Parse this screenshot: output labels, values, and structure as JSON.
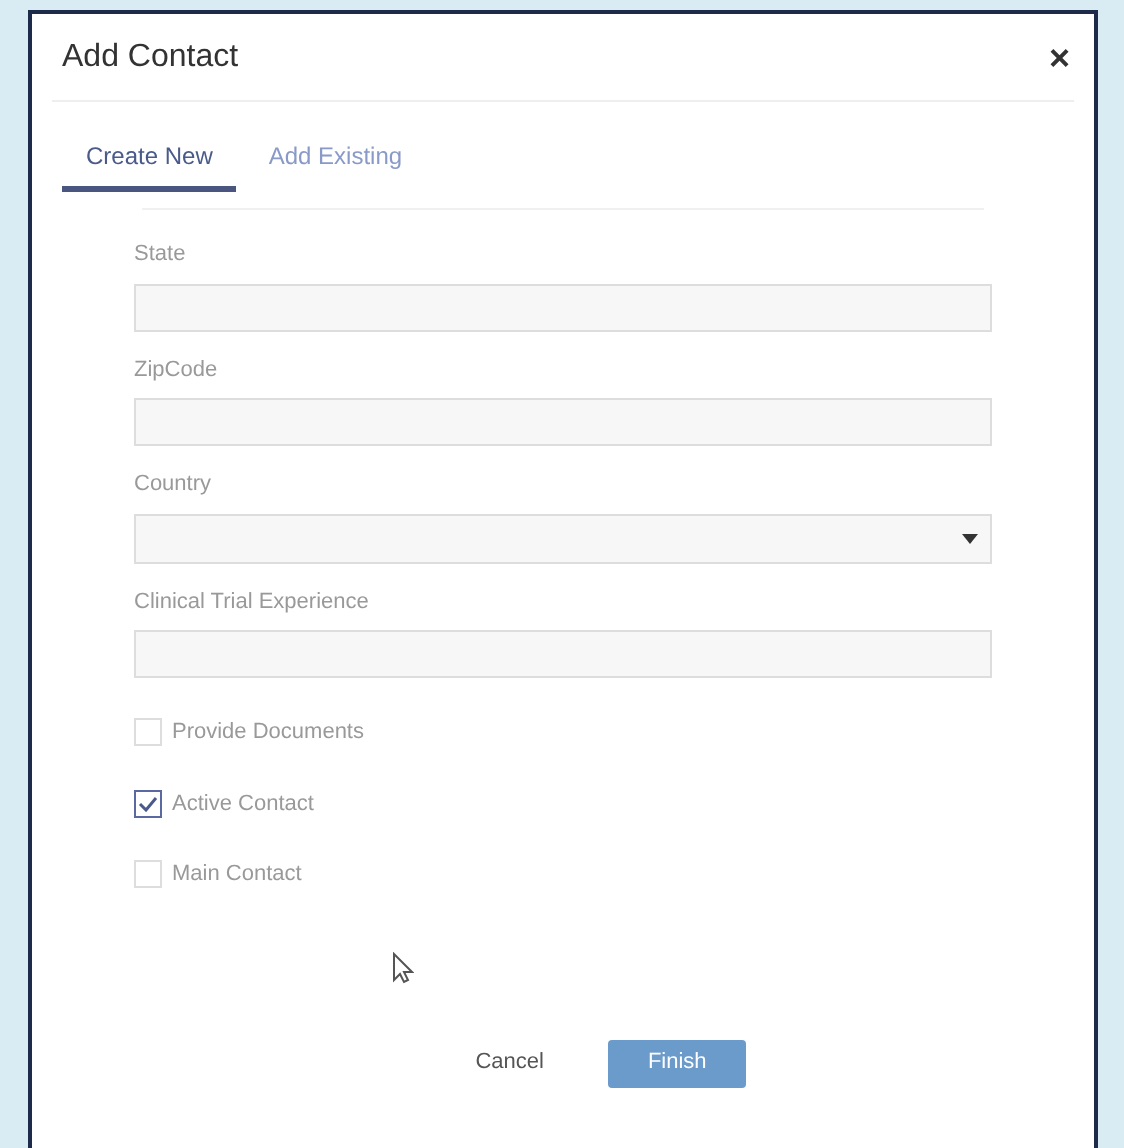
{
  "dialog": {
    "title": "Add Contact",
    "close": "×"
  },
  "tabs": [
    {
      "label": "Create New",
      "selected": true
    },
    {
      "label": "Add Existing",
      "selected": false
    }
  ],
  "fields": [
    {
      "kind": "text",
      "label": "State"
    },
    {
      "kind": "text",
      "label": "ZipCode"
    },
    {
      "kind": "select",
      "label": "Country"
    },
    {
      "kind": "text",
      "label": "Clinical Trial Experience"
    }
  ],
  "checkboxes": [
    {
      "label": "Provide Documents",
      "checked": false
    },
    {
      "label": "Active Contact",
      "checked": true
    },
    {
      "label": "Main Contact",
      "checked": false
    }
  ],
  "buttons": [
    {
      "kind": "secondary",
      "label": "Cancel"
    },
    {
      "kind": "primary",
      "label": "Finish"
    }
  ]
}
